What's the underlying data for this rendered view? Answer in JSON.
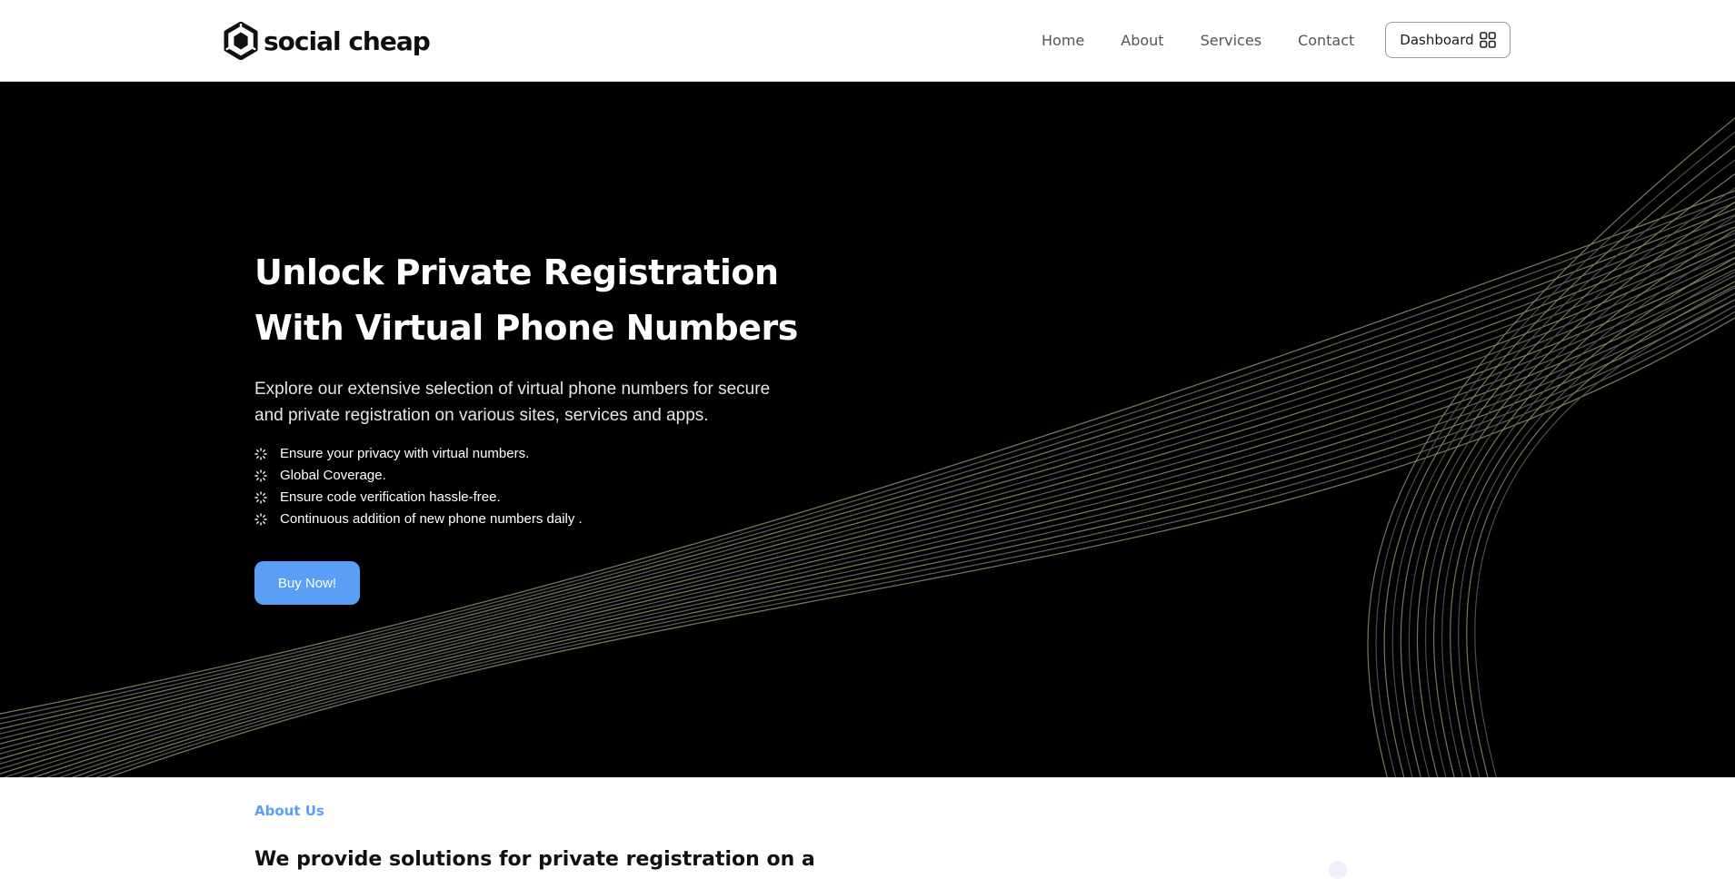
{
  "header": {
    "brand": "social cheap",
    "logo_icon": "hexagon-logo-icon",
    "nav": [
      {
        "label": "Home"
      },
      {
        "label": "About"
      },
      {
        "label": "Services"
      },
      {
        "label": "Contact"
      }
    ],
    "dashboard_label": "Dashboard",
    "dashboard_icon": "grid-icon"
  },
  "hero": {
    "title_line1": "Unlock Private Registration",
    "title_line2": "With Virtual Phone Numbers",
    "subtitle": "Explore our extensive selection of virtual phone numbers for secure and private registration on various sites, services and apps.",
    "features": [
      "Ensure your privacy with virtual numbers.",
      "Global Coverage.",
      "Ensure code verification hassle-free.",
      "Continuous addition of new phone numbers daily ."
    ],
    "feature_icon": "loader-icon",
    "cta_label": "Buy Now!",
    "background": "#000000",
    "wave_color": "#8a8a6a"
  },
  "about": {
    "eyebrow": "About Us",
    "heading": "We provide solutions for private registration on a"
  },
  "colors": {
    "accent": "#5b9ef6",
    "text_dark": "#111111",
    "nav_text": "#555555"
  }
}
